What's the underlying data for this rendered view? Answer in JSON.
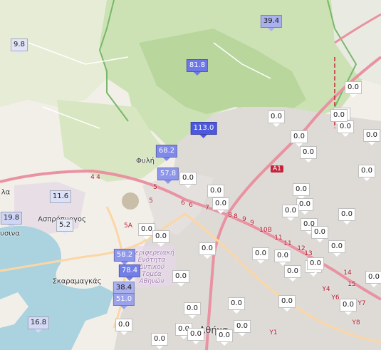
{
  "map": {
    "places": [
      {
        "name": "Φυλή"
      },
      {
        "name": "Ασπρόπυργος"
      },
      {
        "name": "Σκαραμαγκάς"
      },
      {
        "name": "Αθήνα"
      },
      {
        "name": "Περιφερειακή Ενότητα Δυτικού Τομέα Αθηνών"
      },
      {
        "name": "λα"
      },
      {
        "name": "υσινα"
      }
    ],
    "road_shields": [
      {
        "label": "A1"
      }
    ],
    "road_numbers": [
      "4",
      "4",
      "5",
      "5",
      "6",
      "6",
      "7",
      "8",
      "8",
      "9",
      "9",
      "10B",
      "11",
      "11",
      "12",
      "13",
      "14",
      "15",
      "Y1",
      "Y4",
      "Y6",
      "Y7",
      "Y8",
      "5A"
    ],
    "markers": [
      {
        "value": "9.8",
        "color": "#e2e5f8"
      },
      {
        "value": "39.4",
        "color": "#a9b0ee"
      },
      {
        "value": "81.8",
        "color": "#6d78e6"
      },
      {
        "value": "113.0",
        "color": "#4c58de"
      },
      {
        "value": "68.2",
        "color": "#8089e8"
      },
      {
        "value": "57.8",
        "color": "#8d96ea"
      },
      {
        "value": "11.6",
        "color": "#dde1f7"
      },
      {
        "value": "19.8",
        "color": "#cfd5f5"
      },
      {
        "value": "5.2",
        "color": "#e7eaf9"
      },
      {
        "value": "58.2",
        "color": "#8d96ea"
      },
      {
        "value": "78.4",
        "color": "#737ee6"
      },
      {
        "value": "38.4",
        "color": "#aab1ee"
      },
      {
        "value": "51.0",
        "color": "#9aa2ec"
      },
      {
        "value": "16.8",
        "color": "#d4daf6"
      },
      {
        "value": "0.0",
        "color": "#ffffff"
      },
      {
        "value": "0.0",
        "color": "#ffffff"
      },
      {
        "value": "0.0",
        "color": "#ffffff"
      },
      {
        "value": "0.0",
        "color": "#ffffff"
      },
      {
        "value": "0.0",
        "color": "#ffffff"
      },
      {
        "value": "0.0",
        "color": "#ffffff"
      },
      {
        "value": "0.0",
        "color": "#ffffff"
      },
      {
        "value": "0.0",
        "color": "#ffffff"
      },
      {
        "value": "0.0",
        "color": "#ffffff"
      },
      {
        "value": "0.0",
        "color": "#ffffff"
      },
      {
        "value": "0.0",
        "color": "#ffffff"
      },
      {
        "value": "0.0",
        "color": "#ffffff"
      },
      {
        "value": "0.0",
        "color": "#ffffff"
      },
      {
        "value": "0.0",
        "color": "#ffffff"
      },
      {
        "value": "0.0",
        "color": "#ffffff"
      },
      {
        "value": "0.0",
        "color": "#ffffff"
      },
      {
        "value": "0.0",
        "color": "#ffffff"
      },
      {
        "value": "0.0",
        "color": "#ffffff"
      },
      {
        "value": "0.0",
        "color": "#ffffff"
      },
      {
        "value": "0.0",
        "color": "#ffffff"
      },
      {
        "value": "0.0",
        "color": "#ffffff"
      },
      {
        "value": "0.0",
        "color": "#ffffff"
      },
      {
        "value": "0.0",
        "color": "#ffffff"
      },
      {
        "value": "0.0",
        "color": "#ffffff"
      },
      {
        "value": "0.0",
        "color": "#ffffff"
      },
      {
        "value": "0.0",
        "color": "#ffffff"
      },
      {
        "value": "0.0",
        "color": "#ffffff"
      },
      {
        "value": "0.0",
        "color": "#ffffff"
      },
      {
        "value": "0.0",
        "color": "#ffffff"
      },
      {
        "value": "0.0",
        "color": "#ffffff"
      },
      {
        "value": "0.0",
        "color": "#ffffff"
      },
      {
        "value": "0.0",
        "color": "#ffffff"
      },
      {
        "value": "0.0",
        "color": "#ffffff"
      },
      {
        "value": "0.0",
        "color": "#ffffff"
      },
      {
        "value": "0.0",
        "color": "#ffffff"
      },
      {
        "value": "0.0",
        "color": "#ffffff"
      },
      {
        "value": "0.0",
        "color": "#ffffff"
      },
      {
        "value": "0.0",
        "color": "#ffffff"
      },
      {
        "value": "0.0",
        "color": "#ffffff"
      }
    ]
  }
}
